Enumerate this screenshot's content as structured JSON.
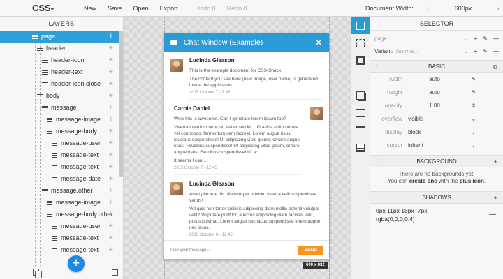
{
  "app": {
    "title": "CSS-Shack"
  },
  "menu": {
    "new": "New",
    "save": "Save",
    "open": "Open",
    "export": "Export",
    "undo": "Undo 0",
    "redo": "Redo 0"
  },
  "doc_width": {
    "label": "Document Width:",
    "value": "600px",
    "left_arrow": "‹",
    "right_arrow": "›"
  },
  "layers_panel": {
    "title": "LAYERS",
    "items": [
      {
        "label": "page",
        "indent": 0,
        "selected": true
      },
      {
        "label": "header",
        "indent": 1
      },
      {
        "label": "header-icon",
        "indent": 2
      },
      {
        "label": "header-text",
        "indent": 2
      },
      {
        "label": "header-icon.close",
        "indent": 2
      },
      {
        "label": "body",
        "indent": 1
      },
      {
        "label": "message",
        "indent": 2
      },
      {
        "label": "message-image",
        "indent": 3
      },
      {
        "label": "message-body",
        "indent": 3
      },
      {
        "label": "message-user",
        "indent": 4
      },
      {
        "label": "message-text",
        "indent": 4
      },
      {
        "label": "message-text",
        "indent": 4
      },
      {
        "label": "message-date",
        "indent": 4
      },
      {
        "label": "message.other",
        "indent": 2
      },
      {
        "label": "message-image",
        "indent": 3
      },
      {
        "label": "message-body.other",
        "indent": 3
      },
      {
        "label": "message-user",
        "indent": 4
      },
      {
        "label": "message-text",
        "indent": 4
      },
      {
        "label": "message-text",
        "indent": 4
      }
    ],
    "fab_label": "+"
  },
  "chat": {
    "title": "Chat Window (Example)",
    "close": "✕",
    "messages": [
      {
        "name": "Lucinda Gleason",
        "p1": "This is the example document for CSS-Shack.",
        "p2": "The content you see here (user image, user name) is generated inside the application.",
        "p3": "",
        "p4": "",
        "date": "2015 October 7 - 7:45"
      },
      {
        "name": "Carole Daniel",
        "p1": "Wow this is awesome. Can I generate lorem ipsum too?",
        "p2": "Viverra interdum nunc at. Vel et sed id.... Gravida enim ornare vel commodo, fermentum sem laoreet. Lorem augue risus, faucibus suspendisse! Ut adipiscing vitae ipsum, ornare augue risus. Faucibus suspendisse! Ut adipiscing vitae ipsum, ornare augue risus. Faucibus suspendisse! Ut ac...",
        "p3": "It seems I can...",
        "p4": "",
        "date": "2015 October 7 - 12:45"
      },
      {
        "name": "Lucinda Gleason",
        "p1": "Amet placerat dis ullamcorper pretium viverra velit suspendisse varius!",
        "p2": "Vel quis non tortor facilisis adipiscing diam mollis potenti volutpat velit? Vulputate porttitor, a lectus adipiscing diam facilisis velit, purus pulvinar. Lorem augue nec lacus suspendisse lorem augue nec lacus.",
        "p3": "",
        "p4": "",
        "date": "2015 October 8 - 12:45"
      }
    ],
    "input_placeholder": "Type your message...",
    "send_label": "SEND",
    "dims": "600 x 832"
  },
  "selector": {
    "title": "SELECTOR",
    "selector_value": "page",
    "variant_label": "Variant:",
    "variant_placeholder": "Normal..."
  },
  "basic": {
    "title": "BASIC",
    "props": [
      {
        "key": "width",
        "value": "auto"
      },
      {
        "key": "height",
        "value": "auto"
      },
      {
        "key": "opacity",
        "value": "1.00"
      },
      {
        "key": "overflow",
        "value": "visible"
      },
      {
        "key": "display",
        "value": "block"
      },
      {
        "key": "cursor",
        "value": "inherit"
      }
    ]
  },
  "background": {
    "title": "BACKGROUND",
    "note_line1": "There are no backgrounds yet.",
    "note_pre": "You can ",
    "note_create": "create one",
    "note_mid": " with the ",
    "note_plus": "plus icon",
    "note_end": "."
  },
  "shadows": {
    "title": "SHADOWS",
    "value_line1": "0px 11px 18px -7px",
    "value_line2": "rgba(0,0,0,0.4)"
  },
  "colors": {
    "accent": "#2b9bd7",
    "send": "#f79422",
    "fab": "#1e88e5"
  }
}
